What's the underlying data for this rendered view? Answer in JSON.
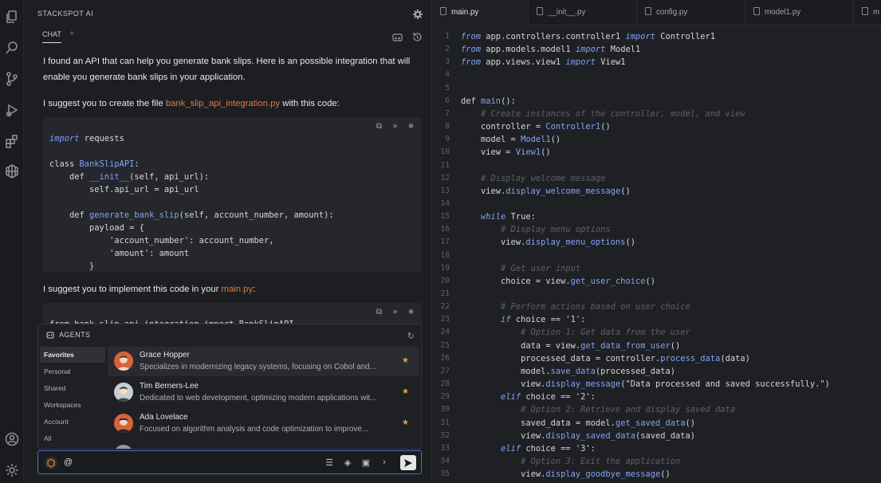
{
  "app": {
    "title": "STACKSPOT AI"
  },
  "chat_tabs": {
    "chat": "CHAT",
    "plus": "+"
  },
  "messages": {
    "m1": "I found an API that can help you generate bank slips. Here is an possible integration that will enable you generate bank slips in your application.",
    "m2_prefix": "I suggest you to create the file ",
    "m2_file": "bank_slip_api_integration.py",
    "m2_suffix": " with this code:",
    "m3_prefix": "I suggest you to implement this code in your ",
    "m3_file": "main.py",
    "m3_suffix": ":"
  },
  "code1": [
    "import requests",
    "",
    "class BankSlipAPI:",
    "    def __init__(self, api_url):",
    "        self.api_url = api_url",
    "",
    "    def generate_bank_slip(self, account_number, amount):",
    "        payload = {",
    "            'account_number': account_number,",
    "            'amount': amount",
    "        }"
  ],
  "code2_first": "from bank_slip_api_integration import BankSlipAPI",
  "agents": {
    "title": "AGENTS",
    "categories": [
      "Favorites",
      "Personal",
      "Shared",
      "Workspaces",
      "Account",
      "All"
    ],
    "list": [
      {
        "name": "Grace Hopper",
        "desc": "Specializes in modernizing legacy systems, focusing on Cobol and..."
      },
      {
        "name": "Tim Berners-Lee",
        "desc": "Dedicated to web development, optimizing modern applications wit..."
      },
      {
        "name": "Ada Lovelace",
        "desc": "Focused on algorithm analysis and code optimization to improve..."
      }
    ]
  },
  "input": {
    "value": "@"
  },
  "editor": {
    "tabs": [
      "main.py",
      "__init__.py",
      "config.py",
      "model1.py",
      "m"
    ],
    "lines": [
      [
        "1",
        "from app.controllers.controller1 import Controller1"
      ],
      [
        "2",
        "from app.models.model1 import Model1"
      ],
      [
        "3",
        "from app.views.view1 import View1"
      ],
      [
        "4",
        ""
      ],
      [
        "5",
        ""
      ],
      [
        "6",
        "def main():"
      ],
      [
        "7",
        "    # Create instances of the controller, model, and view"
      ],
      [
        "8",
        "    controller = Controller1()"
      ],
      [
        "9",
        "    model = Model1()"
      ],
      [
        "10",
        "    view = View1()"
      ],
      [
        "11",
        ""
      ],
      [
        "12",
        "    # Display welcome message"
      ],
      [
        "13",
        "    view.display_welcome_message()"
      ],
      [
        "14",
        ""
      ],
      [
        "15",
        "    while True:"
      ],
      [
        "16",
        "        # Display menu options"
      ],
      [
        "17",
        "        view.display_menu_options()"
      ],
      [
        "18",
        ""
      ],
      [
        "19",
        "        # Get user input"
      ],
      [
        "20",
        "        choice = view.get_user_choice()"
      ],
      [
        "21",
        ""
      ],
      [
        "22",
        "        # Perform actions based on user choice"
      ],
      [
        "23",
        "        if choice == '1':"
      ],
      [
        "24",
        "            # Option 1: Get data from the user"
      ],
      [
        "25",
        "            data = view.get_data_from_user()"
      ],
      [
        "26",
        "            processed_data = controller.process_data(data)"
      ],
      [
        "27",
        "            model.save_data(processed_data)"
      ],
      [
        "28",
        "            view.display_message(\"Data processed and saved successfully.\")"
      ],
      [
        "29",
        "        elif choice == '2':"
      ],
      [
        "30",
        "            # Option 2: Retrieve and display saved data"
      ],
      [
        "31",
        "            saved_data = model.get_saved_data()"
      ],
      [
        "32",
        "            view.display_saved_data(saved_data)"
      ],
      [
        "33",
        "        elif choice == '3':"
      ],
      [
        "34",
        "            # Option 3: Exit the application"
      ],
      [
        "35",
        "            view.display_goodbye_message()"
      ]
    ]
  }
}
